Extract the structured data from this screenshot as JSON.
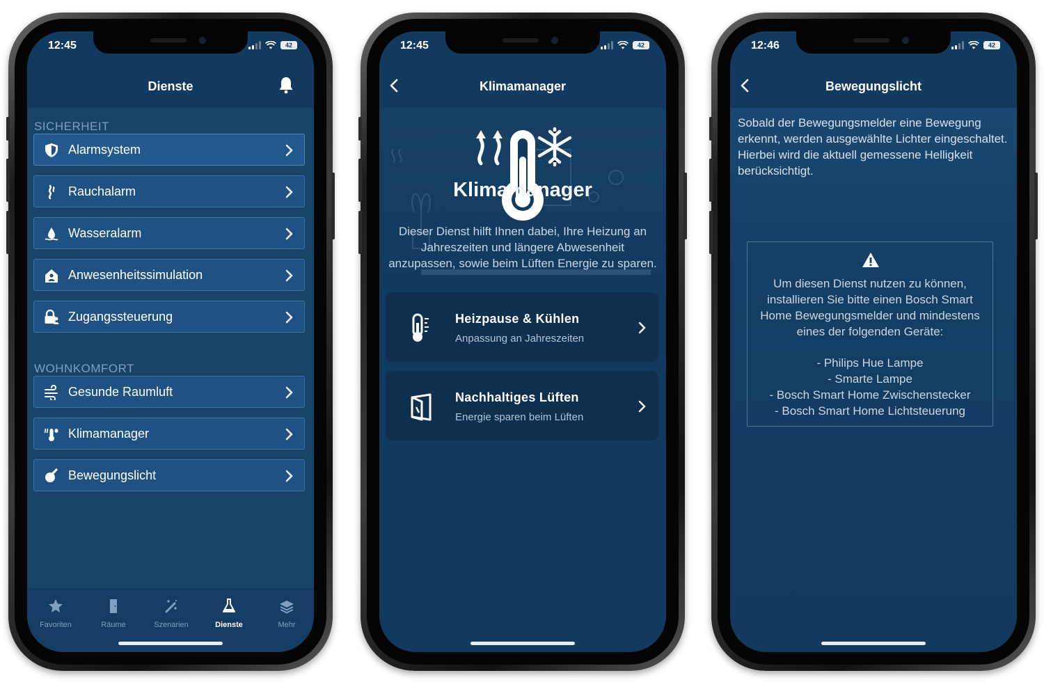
{
  "colors": {
    "screen_bg": "#12395e",
    "list_bg": "#194468",
    "item_bg": "#1f5283",
    "item_border": "#3c73a6",
    "card_bg": "#0e2f4e",
    "section_label": "#7aa0c2",
    "tab_inactive": "#7fa0bf"
  },
  "phone1": {
    "status": {
      "time": "12:45",
      "battery": "42"
    },
    "header": {
      "title": "Dienste",
      "icon": "bell-icon"
    },
    "sections": [
      {
        "label": "SICHERHEIT",
        "items": [
          {
            "label": "Alarmsystem",
            "icon": "shield-icon"
          },
          {
            "label": "Rauchalarm",
            "icon": "smoke-icon"
          },
          {
            "label": "Wasseralarm",
            "icon": "water-drop-icon"
          },
          {
            "label": "Anwesenheitssimulation",
            "icon": "house-person-icon"
          },
          {
            "label": "Zugangssteuerung",
            "icon": "lock-person-icon"
          }
        ]
      },
      {
        "label": "WOHNKOMFORT",
        "items": [
          {
            "label": "Gesunde Raumluft",
            "icon": "air-flow-icon"
          },
          {
            "label": "Klimamanager",
            "icon": "thermometer-snowflake-icon"
          },
          {
            "label": "Bewegungslicht",
            "icon": "motion-light-icon"
          }
        ]
      }
    ],
    "tabs": [
      {
        "label": "Favoriten",
        "icon": "star-icon",
        "active": false
      },
      {
        "label": "Räume",
        "icon": "door-icon",
        "active": false
      },
      {
        "label": "Szenarien",
        "icon": "magic-wand-icon",
        "active": false
      },
      {
        "label": "Dienste",
        "icon": "flask-icon",
        "active": true
      },
      {
        "label": "Mehr",
        "icon": "layers-icon",
        "active": false
      }
    ]
  },
  "phone2": {
    "status": {
      "time": "12:45",
      "battery": "42"
    },
    "header": {
      "title": "Klimamanager",
      "back_icon": "chevron-left-icon"
    },
    "hero_title": "Klimamanager",
    "description": "Dieser Dienst hilft Ihnen dabei, Ihre Heizung an Jahreszeiten und längere Abwesenheit anzupassen, sowie beim Lüften Energie zu sparen.",
    "cards": [
      {
        "title": "Heizpause & Kühlen",
        "subtitle": "Anpassung an Jahreszeiten",
        "icon": "thermometer-icon"
      },
      {
        "title": "Nachhaltiges Lüften",
        "subtitle": "Energie sparen beim Lüften",
        "icon": "open-window-icon"
      }
    ]
  },
  "phone3": {
    "status": {
      "time": "12:46",
      "battery": "42"
    },
    "header": {
      "title": "Bewegungslicht",
      "back_icon": "chevron-left-icon"
    },
    "description": "Sobald der Bewegungsmelder eine Bewegung erkennt, werden ausgewählte Lichter eingeschaltet. Hierbei wird die aktuell gemessene Helligkeit berücksichtigt.",
    "notice": {
      "icon": "warning-icon",
      "text": "Um diesen Dienst nutzen zu können, installieren Sie bitte einen Bosch Smart Home Bewegungsmelder und mindestens eines der folgenden Geräte:",
      "devices": [
        "- Philips Hue Lampe",
        "- Smarte Lampe",
        "- Bosch Smart Home Zwischenstecker",
        "- Bosch Smart Home Lichtsteuerung"
      ]
    }
  }
}
